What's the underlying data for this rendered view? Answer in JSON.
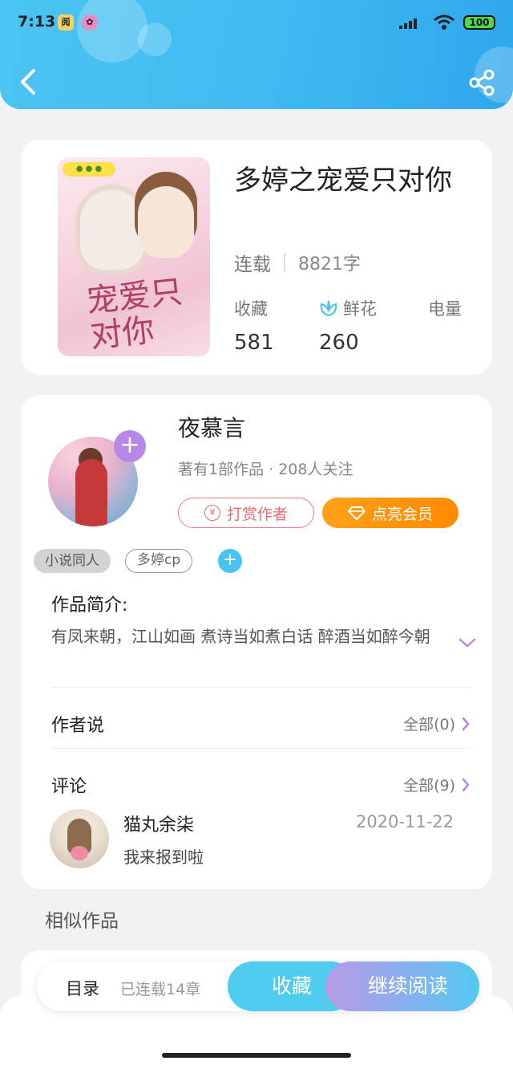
{
  "status_bar": {
    "time": "7:13",
    "battery": "100"
  },
  "book": {
    "title": "多婷之宠爱只对你",
    "cover_title": "宠爱只对你",
    "status": "连载",
    "word_count": "8821字",
    "stats": [
      {
        "label": "收藏",
        "value": "581"
      },
      {
        "label": "鲜花",
        "value": "260"
      },
      {
        "label": "电量",
        "value": ""
      }
    ]
  },
  "author": {
    "name": "夜慕言",
    "info": "著有1部作品 · 208人关注",
    "tip_button": "打赏作者",
    "vip_button": "点亮会员",
    "follow_symbol": "+"
  },
  "tags": [
    "小说同人",
    "多婷cp"
  ],
  "intro": {
    "label": "作品简介:",
    "text": "有凤来朝，江山如画 煮诗当如煮白话  醉酒当如醉今朝"
  },
  "author_says": {
    "label": "作者说",
    "link": "全部(0)"
  },
  "comments": {
    "label": "评论",
    "link": "全部(9)",
    "items": [
      {
        "user": "猫丸余柒",
        "date": "2020-11-22",
        "text": "我来报到啦"
      }
    ]
  },
  "similar": {
    "title": "相似作品"
  },
  "bottom_bar": {
    "catalog": "目录",
    "chapters": "已连载14章",
    "collect": "收藏",
    "read": "继续阅读"
  },
  "colors": {
    "header": "#3fb9f0",
    "accent_orange": "#ff8a00",
    "accent_purple": "#b887e6",
    "tip_red": "#ec6a6a"
  }
}
